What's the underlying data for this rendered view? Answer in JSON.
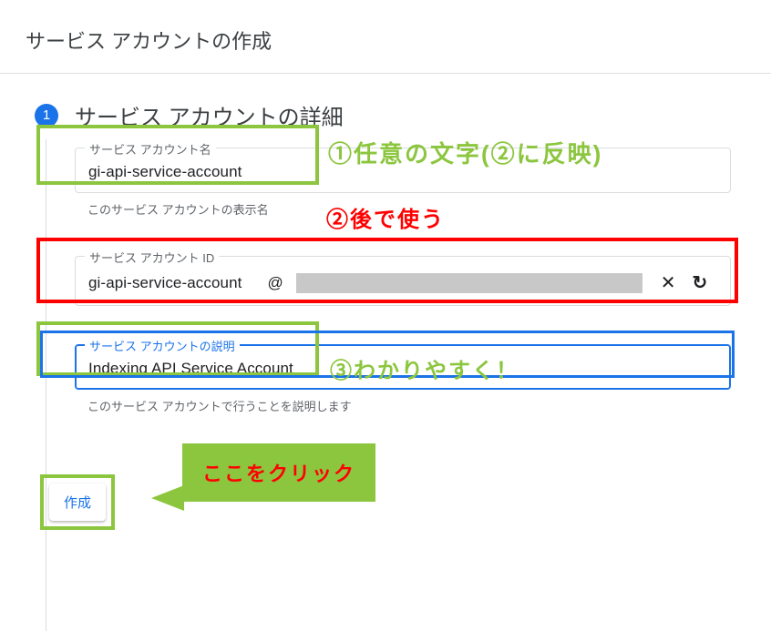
{
  "header": {
    "title": "サービス アカウントの作成"
  },
  "step": {
    "number": "1",
    "title": "サービス アカウントの詳細"
  },
  "fields": {
    "name": {
      "label": "サービス アカウント名",
      "value": "gi-api-service-account",
      "helper": "このサービス アカウントの表示名"
    },
    "id": {
      "label": "サービス アカウント ID",
      "value": "gi-api-service-account",
      "at": "@",
      "clear_icon": "✕",
      "refresh_icon": "↻"
    },
    "desc": {
      "label": "サービス アカウントの説明",
      "value": "Indexing API Service Account",
      "helper": "このサービス アカウントで行うことを説明します"
    }
  },
  "button": {
    "create": "作成"
  },
  "annotations": {
    "a1": "①任意の文字(②に反映)",
    "a2": "②後で使う",
    "a3": "③わかりやすく！",
    "callout": "ここをクリック"
  }
}
